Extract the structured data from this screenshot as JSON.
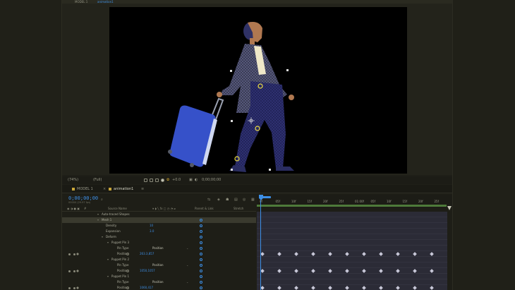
{
  "top_tabs": [
    "MODEL 1",
    "animation1"
  ],
  "viewer_toolbar": {
    "zoom": "(74%)",
    "quality": "(Full)",
    "exposure": "+0.0",
    "timecode": "0;00;00;00"
  },
  "timeline": {
    "tabs": [
      {
        "label": "MODEL 1",
        "active": false
      },
      {
        "label": "animation1",
        "active": true
      }
    ],
    "current_time": "0;00;00;00",
    "current_time_sub": "00000 (29.97 fps)",
    "column_headers": {
      "source_name": "Source Name",
      "parent": "Parent & Link",
      "stretch": "Stretch"
    },
    "ruler_labels": [
      "0f",
      "05f",
      "10f",
      "15f",
      "20f",
      "25f",
      "01:00f",
      "05f",
      "10f",
      "15f",
      "20f",
      "25f"
    ],
    "layers": [
      {
        "indent": 1,
        "label": "Auto-traced Shapes",
        "value": "",
        "type": "group"
      },
      {
        "indent": 1,
        "label": "Mesh 1",
        "value": "",
        "type": "group",
        "selected": true
      },
      {
        "indent": 2,
        "label": "Density",
        "value": "10",
        "type": "prop"
      },
      {
        "indent": 2,
        "label": "Expansion",
        "value": "3.0",
        "type": "prop"
      },
      {
        "indent": 2,
        "label": "Deform",
        "value": "",
        "type": "group"
      },
      {
        "indent": 3,
        "label": "Puppet Pin 3",
        "value": "",
        "type": "group"
      },
      {
        "indent": 4,
        "label": "Pin Type",
        "value": "Position",
        "type": "pin"
      },
      {
        "indent": 4,
        "label": "Position",
        "value": "263.3,857",
        "type": "pos",
        "keys": true
      },
      {
        "indent": 3,
        "label": "Puppet Pin 2",
        "value": "",
        "type": "group"
      },
      {
        "indent": 4,
        "label": "Pin Type",
        "value": "Position",
        "type": "pin"
      },
      {
        "indent": 4,
        "label": "Position",
        "value": "1050,1057",
        "type": "pos",
        "keys": true
      },
      {
        "indent": 3,
        "label": "Puppet Pin 1",
        "value": "",
        "type": "group"
      },
      {
        "indent": 4,
        "label": "Pin Type",
        "value": "Position",
        "type": "pin"
      },
      {
        "indent": 4,
        "label": "Position",
        "value": "1060,417",
        "type": "pos",
        "keys": true
      }
    ]
  },
  "colors": {
    "accent": "#3d8fe6",
    "label_yellow": "#c9a73a",
    "graph_bg": "#2b2b36",
    "suitcase": "#3651c9",
    "character_top": "#3a3c56",
    "pants": "#252763"
  }
}
